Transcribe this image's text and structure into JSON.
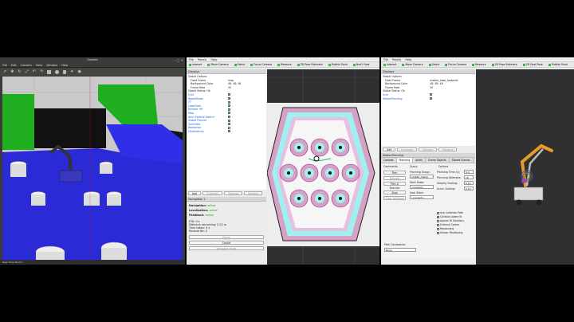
{
  "gazebo": {
    "title": "Gazebo",
    "menu": [
      "File",
      "Edit",
      "Camera",
      "View",
      "Window",
      "Help"
    ],
    "status": "Real Time Factor:"
  },
  "rviz_left": {
    "menu": [
      "File",
      "Panels",
      "Help"
    ],
    "toolbar": [
      "Interact",
      "Move Camera",
      "Select",
      "Focus Camera",
      "Measure",
      "2D Pose Estimate",
      "Publish Point",
      "Nav2 Goal"
    ],
    "displays_title": "Displays",
    "tree": [
      {
        "k": "Global Options",
        "v": ""
      },
      {
        "k": "Fixed Frame",
        "v": "map"
      },
      {
        "k": "Background Color",
        "v": "48; 48; 48"
      },
      {
        "k": "Frame Rate",
        "v": "30"
      },
      {
        "k": "Global Status: Ok",
        "v": ""
      },
      {
        "k": "Grid",
        "v": ""
      },
      {
        "k": "RobotModel",
        "v": ""
      },
      {
        "k": "TF",
        "v": ""
      },
      {
        "k": "LaserScan",
        "v": ""
      },
      {
        "k": "Bumper Hit",
        "v": ""
      },
      {
        "k": "Map",
        "v": ""
      },
      {
        "k": "Amcl Particle Swarm",
        "v": ""
      },
      {
        "k": "Global Planner",
        "v": ""
      },
      {
        "k": "Controller",
        "v": ""
      },
      {
        "k": "Realsense",
        "v": ""
      },
      {
        "k": "MarkerArray",
        "v": ""
      }
    ],
    "buttons": [
      "Add",
      "Duplicate",
      "Remove",
      "Rename"
    ],
    "nav_title": "Navigation 2",
    "nav": [
      {
        "k": "Navigation:",
        "v": "active"
      },
      {
        "k": "Localization:",
        "v": "active"
      },
      {
        "k": "Feedback:",
        "v": "active"
      }
    ],
    "nav_details": [
      {
        "k": "ETA:",
        "v": "0 s"
      },
      {
        "k": "Distance remaining:",
        "v": "0.52 m"
      },
      {
        "k": "Time taken:",
        "v": "5 s"
      },
      {
        "k": "Recoveries:",
        "v": "0"
      }
    ],
    "nav_buttons": [
      "Pause",
      "Cancel",
      "Waypoint mode"
    ]
  },
  "rviz_right": {
    "menu": [
      "File",
      "Panels",
      "Help"
    ],
    "toolbar": [
      "Interact",
      "Move Camera",
      "Select",
      "Focus Camera",
      "Measure",
      "2D Pose Estimate",
      "2D Goal Pose",
      "Publish Point"
    ],
    "displays_title": "Displays",
    "tree": [
      {
        "k": "Global Options",
        "v": ""
      },
      {
        "k": "Fixed Frame",
        "v": "mobile_base_footprint"
      },
      {
        "k": "Background Color",
        "v": "48; 48; 48"
      },
      {
        "k": "Frame Rate",
        "v": "30"
      },
      {
        "k": "Global Status: Ok",
        "v": ""
      },
      {
        "k": "Grid",
        "v": ""
      },
      {
        "k": "MotionPlanning",
        "v": ""
      }
    ],
    "buttons": [
      "Add",
      "Duplicate",
      "Remove",
      "Rename"
    ],
    "mp_title": "MotionPlanning",
    "tabs": [
      "Context",
      "Planning",
      "Joints",
      "Scene Objects",
      "Stored Scenes",
      "Stored States"
    ],
    "commands_label": "Commands",
    "query_label": "Query",
    "options_label": "Options",
    "cmd_buttons": [
      "Plan",
      "Execute",
      "Plan & Execute",
      "Stop",
      "Clear octomap"
    ],
    "planning_group_label": "Planning Group:",
    "planning_group": "mobile_manip",
    "start_state_label": "Start State:",
    "start_state": "<current>",
    "goal_state_label": "Goal State:",
    "goal_state": "<current>",
    "options": [
      {
        "k": "Planning Time (s):",
        "v": "5.0"
      },
      {
        "k": "Planning Attempts:",
        "v": "10"
      },
      {
        "k": "Velocity Scaling:",
        "v": "0.10"
      },
      {
        "k": "Accel. Scaling:",
        "v": "0.10"
      }
    ],
    "checks": [
      "Use Cartesian Path",
      "Collision-aware IK",
      "Approx IK Solutions",
      "External Comm.",
      "Replanning",
      "Sensor Positioning"
    ],
    "path_constraints_label": "Path Constraints:",
    "path_constraints": "None",
    "status": "Reset"
  }
}
